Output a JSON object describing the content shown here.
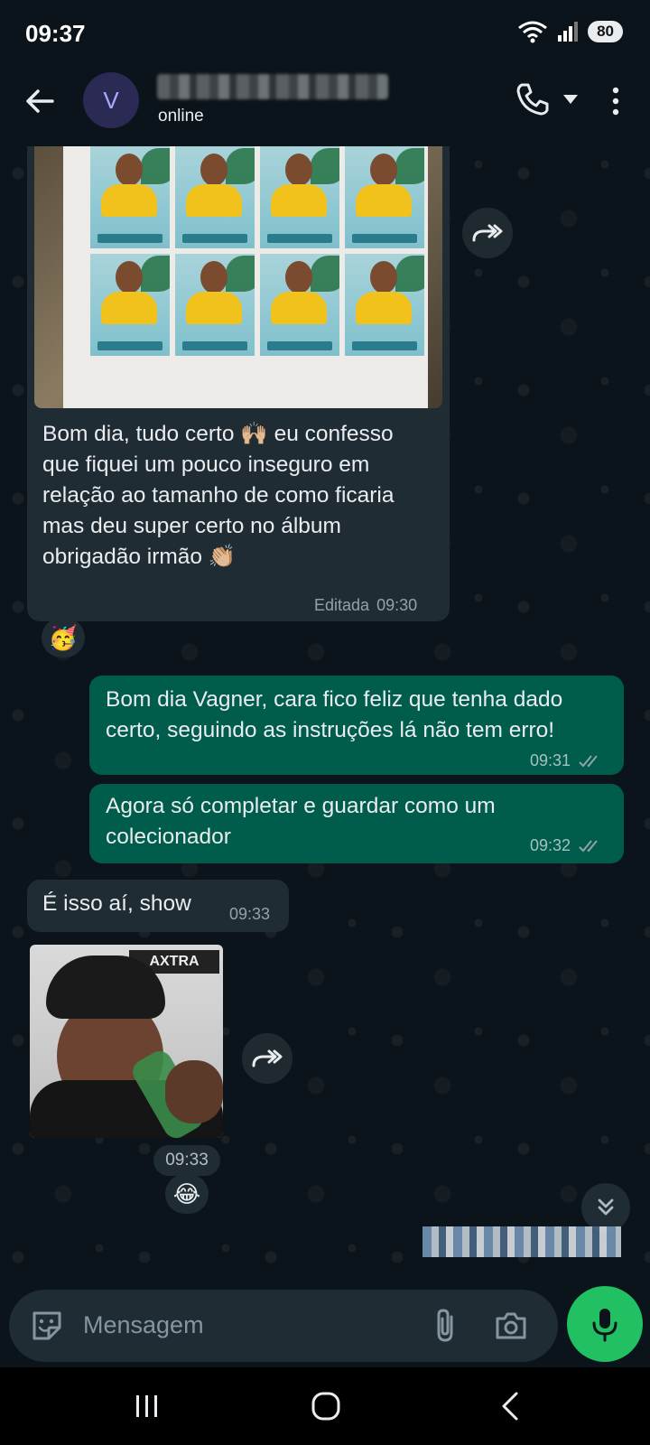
{
  "status": {
    "time": "09:37",
    "battery": "80"
  },
  "header": {
    "avatar_letter": "V",
    "contact_status": "online"
  },
  "messages": [
    {
      "direction": "in",
      "text": "Bom dia, tudo certo 🙌🏼 eu confesso que fiquei um pouco inseguro em relação ao tamanho de como ficaria mas deu super certo no álbum obrigadão irmão 👏🏼",
      "edited_label": "Editada",
      "time": "09:30",
      "reaction": "🥳"
    },
    {
      "direction": "out",
      "text": "Bom dia Vagner, cara fico feliz que tenha dado certo, seguindo as instruções lá não tem erro!",
      "time": "09:31"
    },
    {
      "direction": "out",
      "text": "Agora só completar e guardar como um colecionador",
      "time": "09:32"
    },
    {
      "direction": "in",
      "text": "É isso aí, show",
      "time": "09:33"
    },
    {
      "direction": "in",
      "type": "gif",
      "sign_text": "AXTRA",
      "time": "09:33",
      "reaction": "😂"
    }
  ],
  "input": {
    "placeholder": "Mensagem"
  },
  "colors": {
    "background": "#0b141a",
    "incoming_bubble": "#202c33",
    "outgoing_bubble": "#005c4b",
    "mic_button": "#21c063",
    "read_ticks": "#8fa3ad"
  },
  "icons": [
    "back-arrow-icon",
    "phone-icon",
    "dropdown-icon",
    "more-vert-icon",
    "forward-icon",
    "read-receipt-icon",
    "chevron-double-down-icon",
    "emoji-icon",
    "attach-icon",
    "camera-icon",
    "mic-icon",
    "wifi-icon",
    "signal-icon"
  ]
}
